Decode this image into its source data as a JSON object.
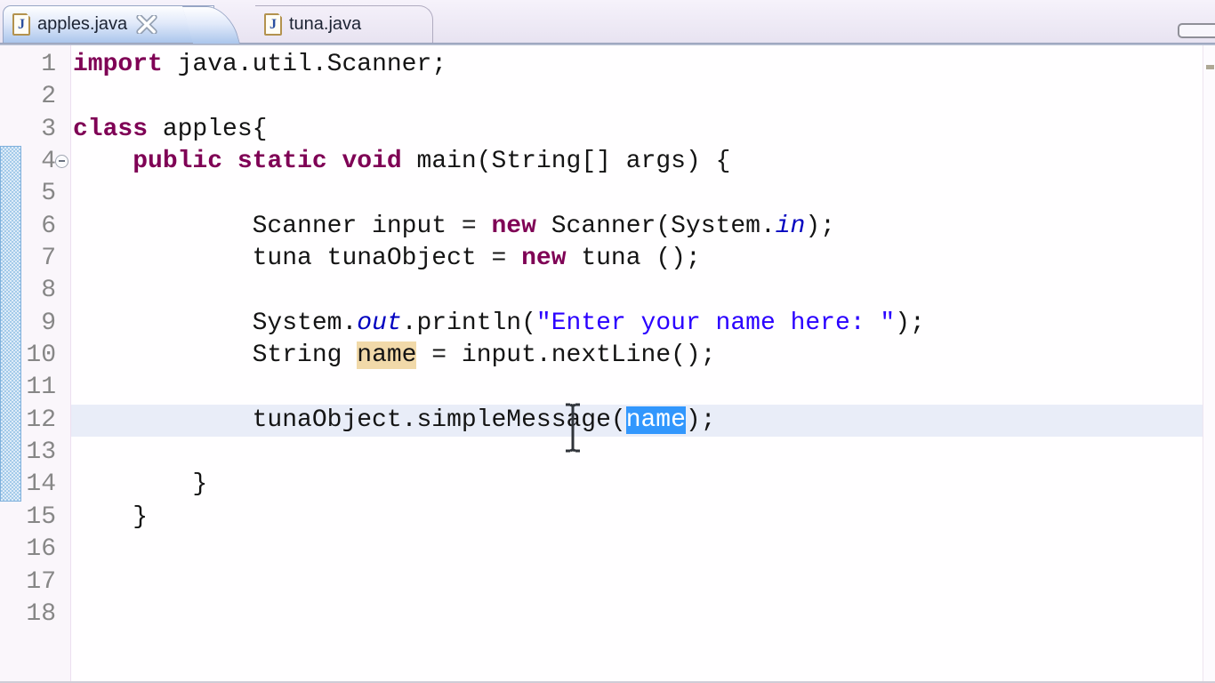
{
  "tabs": [
    {
      "label": "apples.java",
      "active": true,
      "icon": "java-file-icon",
      "closable": true
    },
    {
      "label": "tuna.java",
      "active": false,
      "icon": "java-file-icon",
      "closable": false
    }
  ],
  "icons": {
    "java_file_letter": "J",
    "close": "close-icon",
    "fold_collapse": "collapse-minus-icon",
    "pointer": "text-ibeam-cursor"
  },
  "editor": {
    "language": "java",
    "current_line": 12,
    "fold_line": 4,
    "range_indicator": {
      "from_line": 4,
      "to_line": 14
    },
    "lines": [
      {
        "n": 1,
        "seg": [
          [
            "kw",
            "import"
          ],
          [
            "p",
            " java.util.Scanner;"
          ]
        ]
      },
      {
        "n": 2,
        "seg": []
      },
      {
        "n": 3,
        "seg": [
          [
            "kw",
            "class"
          ],
          [
            "p",
            " apples{"
          ]
        ]
      },
      {
        "n": 4,
        "seg": [
          [
            "p",
            "    "
          ],
          [
            "kw",
            "public"
          ],
          [
            "p",
            " "
          ],
          [
            "kw",
            "static"
          ],
          [
            "p",
            " "
          ],
          [
            "kw",
            "void"
          ],
          [
            "p",
            " main(String[] args) {"
          ]
        ]
      },
      {
        "n": 5,
        "seg": []
      },
      {
        "n": 6,
        "seg": [
          [
            "p",
            "            Scanner input = "
          ],
          [
            "kw",
            "new"
          ],
          [
            "p",
            " Scanner(System."
          ],
          [
            "fld",
            "in"
          ],
          [
            "p",
            ");"
          ]
        ]
      },
      {
        "n": 7,
        "seg": [
          [
            "p",
            "            tuna tunaObject = "
          ],
          [
            "kw",
            "new"
          ],
          [
            "p",
            " tuna ();"
          ]
        ]
      },
      {
        "n": 8,
        "seg": []
      },
      {
        "n": 9,
        "seg": [
          [
            "p",
            "            System."
          ],
          [
            "fld",
            "out"
          ],
          [
            "p",
            ".println("
          ],
          [
            "str",
            "\"Enter your name here: \""
          ],
          [
            "p",
            ");"
          ]
        ]
      },
      {
        "n": 10,
        "seg": [
          [
            "p",
            "            String "
          ],
          [
            "occ",
            "name"
          ],
          [
            "p",
            " = input.nextLine();"
          ]
        ]
      },
      {
        "n": 11,
        "seg": []
      },
      {
        "n": 12,
        "seg": [
          [
            "p",
            "            tunaObject.simpleMessage("
          ],
          [
            "sel",
            "name"
          ],
          [
            "p",
            ");"
          ]
        ]
      },
      {
        "n": 13,
        "seg": []
      },
      {
        "n": 14,
        "seg": [
          [
            "p",
            "        }"
          ]
        ]
      },
      {
        "n": 15,
        "seg": [
          [
            "p",
            "    }"
          ]
        ]
      },
      {
        "n": 16,
        "seg": []
      },
      {
        "n": 17,
        "seg": []
      },
      {
        "n": 18,
        "seg": []
      }
    ]
  },
  "colors": {
    "keyword": "#7F0055",
    "string": "#2A00FF",
    "static_field": "#0000C0",
    "plain": "#141414",
    "line_number": "#878787",
    "current_line_bg": "#E9EDF8",
    "occurrence_bg": "#F1D9A9",
    "selection_bg": "#3297FD",
    "selection_text": "#FFFFFF",
    "range_indicator": "#A3CAE9",
    "tab_active_gradient_bottom": "#ABC6EC"
  }
}
